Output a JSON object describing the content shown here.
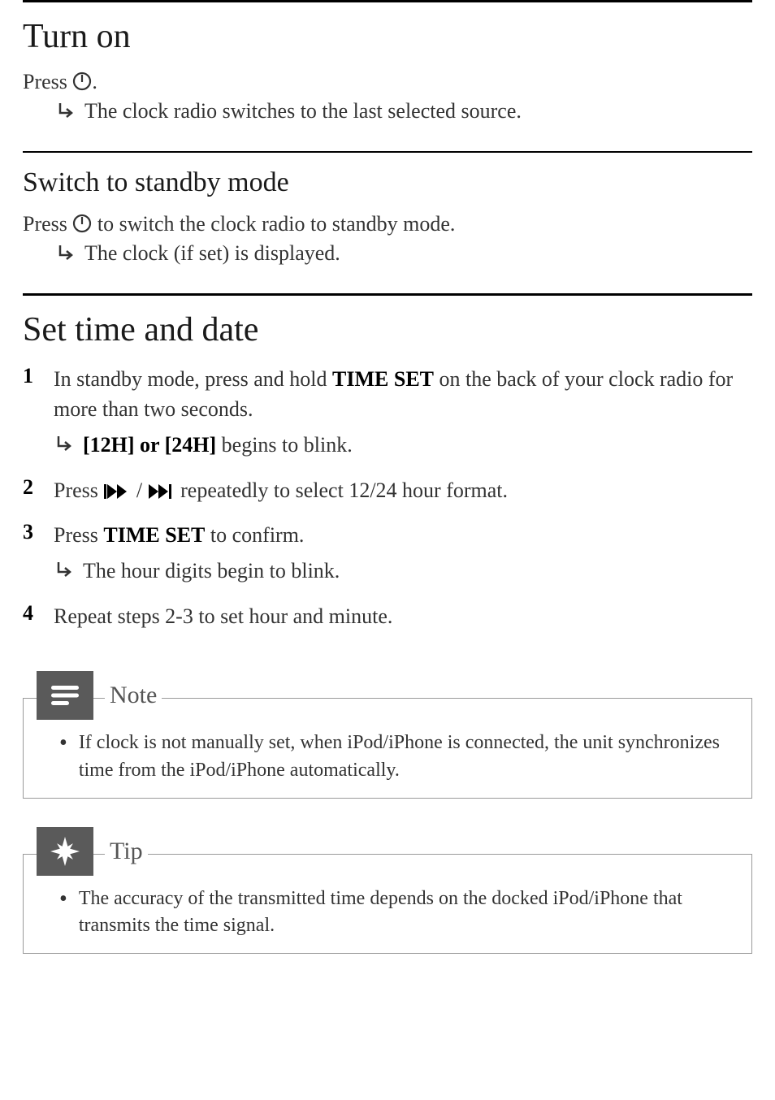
{
  "sections": {
    "turn_on": {
      "heading": "Turn on",
      "press_text_pre": "Press ",
      "press_text_post": ".",
      "result": "The clock radio switches to the last selected source."
    },
    "standby": {
      "heading": "Switch to standby mode",
      "press_text_pre": "Press ",
      "press_text_post": " to switch the clock radio to standby mode.",
      "result": "The clock (if set) is displayed."
    },
    "set_time": {
      "heading": "Set time and date",
      "steps": [
        {
          "num": "1",
          "text_pre": "In standby mode, press and hold ",
          "bold1": "TIME SET",
          "text_mid": " on the back of your clock radio for more than two seconds.",
          "result_bold": "[12H] or [24H]",
          "result_rest": " begins to blink."
        },
        {
          "num": "2",
          "text_pre": "Press ",
          "text_post": " repeatedly to select 12/24 hour format."
        },
        {
          "num": "3",
          "text_pre": "Press ",
          "bold1": "TIME SET",
          "text_post": " to confirm.",
          "result": "The hour digits begin to blink."
        },
        {
          "num": "4",
          "text": "Repeat steps 2-3 to set hour and minute."
        }
      ]
    }
  },
  "callouts": {
    "note": {
      "title": "Note",
      "body": "If clock is not manually set, when iPod/iPhone is connected, the unit synchronizes time from the iPod/iPhone automatically."
    },
    "tip": {
      "title": "Tip",
      "body": "The accuracy of the transmitted time depends on the docked iPod/iPhone that transmits the time signal."
    }
  }
}
